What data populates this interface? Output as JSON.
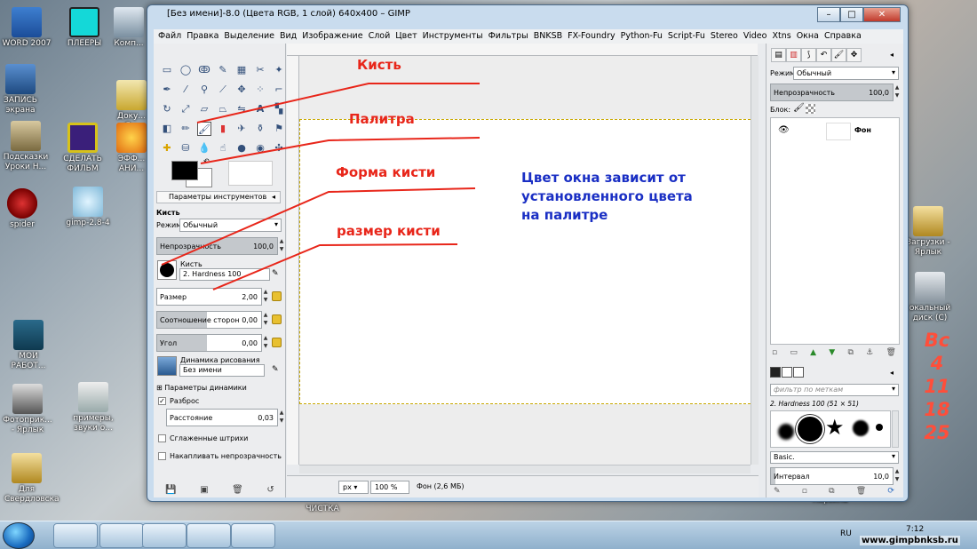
{
  "desktop": {
    "icons_left": [
      {
        "name": "word-icon",
        "label": "WORD 2007"
      },
      {
        "name": "players-icon",
        "label": "ПЛЕЕРЫ"
      },
      {
        "name": "computer-icon",
        "label": "Комп..."
      },
      {
        "name": "screen-record-icon",
        "label": "ЗАПИСЬ экрана"
      },
      {
        "name": "lessons-icon",
        "label": "Подсказки Уроки Н..."
      },
      {
        "name": "make-film-icon",
        "label": "СДЕЛАТЬ ФИЛЬМ"
      },
      {
        "name": "docs-icon",
        "label": "Доку... Я..."
      },
      {
        "name": "effects-icon",
        "label": "ЭФФ... АНИ..."
      },
      {
        "name": "spider-icon",
        "label": "spider"
      },
      {
        "name": "gimp-icon",
        "label": "gimp-2.8-4"
      },
      {
        "name": "my-works-icon",
        "label": "МОИ РАБОТ..."
      },
      {
        "name": "photo-icon",
        "label": "Фотоприк... - Ярлык"
      },
      {
        "name": "examples-icon",
        "label": "примеры, звуки о..."
      },
      {
        "name": "sverdlovsk-icon",
        "label": "Для Свердловска"
      }
    ],
    "icons_right": [
      {
        "name": "downloads-icon",
        "label": "Загрузки - Ярлык"
      },
      {
        "name": "local-disk-icon",
        "label": "окальный диск (C)"
      },
      {
        "name": "recycle-bin-icon",
        "label": "Корзина"
      }
    ],
    "bottom_label": "ЧИСТКА",
    "calendar": [
      "Вс",
      "4",
      "11",
      "18",
      "25"
    ]
  },
  "taskbar": {
    "lang": "RU",
    "time": "7:12",
    "watermark": "www.gimpbnksb.ru"
  },
  "window": {
    "title": "[Без имени]-8.0 (Цвета RGB, 1 слой) 640x400 – GIMP",
    "menu": [
      "Файл",
      "Правка",
      "Выделение",
      "Вид",
      "Изображение",
      "Слой",
      "Цвет",
      "Инструменты",
      "Фильтры",
      "BNKSB",
      "FX-Foundry",
      "Python-Fu",
      "Script-Fu",
      "Stereo",
      "Video",
      "Xtns",
      "Окна",
      "Справка"
    ]
  },
  "tool_options": {
    "tab_label": "Параметры инструментов",
    "tool_name": "Кисть",
    "mode_label": "Режим:",
    "mode_value": "Обычный",
    "opacity_label": "Непрозрачность",
    "opacity_value": "100,0",
    "opacity_fraction": 1.0,
    "brush_label": "Кисть",
    "brush_value": "2. Hardness 100",
    "size_label": "Размер",
    "size_value": "2,00",
    "aspect_label": "Соотношение сторон",
    "aspect_value": "0,00",
    "angle_label": "Угол",
    "angle_value": "0,00",
    "dynamics_label": "Динамика рисования",
    "dynamics_value": "Без имени",
    "dynamics_params": "Параметры динамики",
    "jitter_label": "Разброс",
    "jitter_checked": true,
    "distance_label": "Расстояние",
    "distance_value": "0,03",
    "smooth_label": "Сглаженные штрихи",
    "accumulate_label": "Накапливать непрозрачность"
  },
  "annotations": {
    "brush": "Кисть",
    "palette": "Палитра",
    "brush_shape": "Форма кисти",
    "brush_size": "размер кисти",
    "note": [
      "Цвет окна зависит от",
      "установленного цвета",
      "на палитре"
    ]
  },
  "status": {
    "unit": "px",
    "zoom": "100 %",
    "info": "Фон (2,6 МБ)"
  },
  "layers": {
    "mode_label": "Режим:",
    "mode_value": "Обычный",
    "opacity_label": "Непрозрачность",
    "opacity_value": "100,0",
    "lock_label": "Блок:",
    "layer_name": "Фон"
  },
  "brushes": {
    "filter_placeholder": "фильтр по меткам",
    "current": "2. Hardness 100 (51 × 51)",
    "preset": "Basic.",
    "spacing_label": "Интервал",
    "spacing_value": "10,0"
  },
  "colors": {
    "annotation_red": "#e8261a",
    "note_blue": "#1a2fc4",
    "selection_dash": "#c8a800"
  }
}
